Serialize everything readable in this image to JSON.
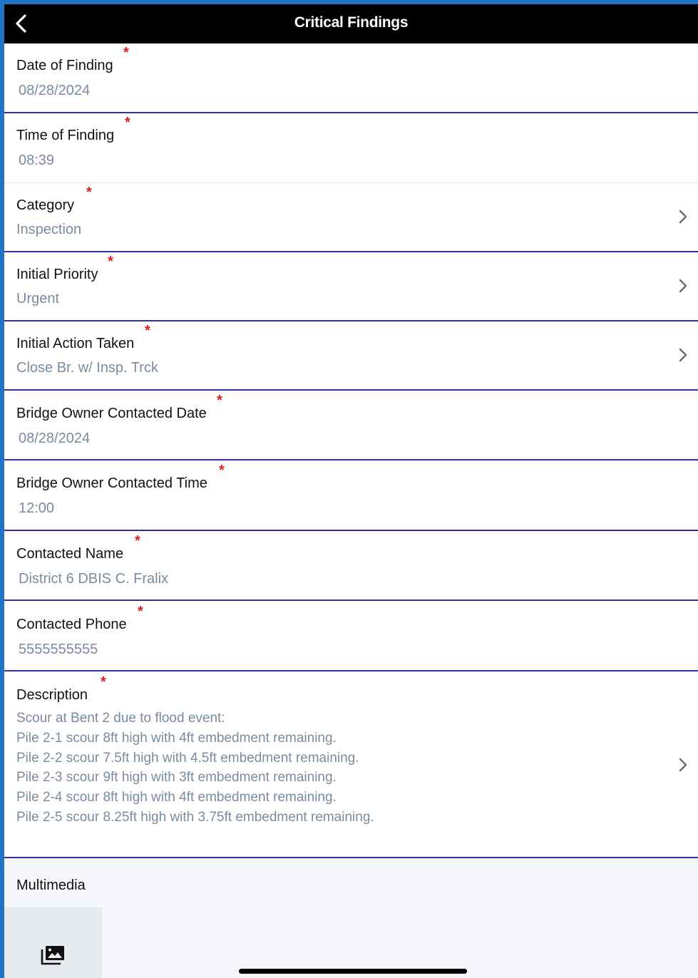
{
  "nav": {
    "title": "Critical Findings"
  },
  "fields": [
    {
      "label": "Date of Finding",
      "value": "08/28/2024",
      "required": true
    },
    {
      "label": "Time of Finding",
      "value": "08:39",
      "required": true
    },
    {
      "label": "Category",
      "value": "Inspection",
      "required": true
    },
    {
      "label": "Initial Priority",
      "value": "Urgent",
      "required": true
    },
    {
      "label": "Initial Action Taken",
      "value": "Close Br. w/ Insp. Trck",
      "required": true
    },
    {
      "label": "Bridge Owner Contacted Date",
      "value": "08/28/2024",
      "required": true
    },
    {
      "label": "Bridge Owner Contacted Time",
      "value": "12:00",
      "required": true
    },
    {
      "label": "Contacted Name",
      "value": "District 6 DBIS C. Fralix",
      "required": true
    },
    {
      "label": "Contacted Phone",
      "value": "5555555555",
      "required": true
    }
  ],
  "description": {
    "label": "Description",
    "required": true,
    "lines": [
      "Scour at Bent 2 due to flood event:",
      "Pile 2-1 scour 8ft high with 4ft embedment remaining.",
      "Pile 2-2 scour 7.5ft high with 4.5ft embedment remaining.",
      "Pile 2-3 scour 9ft high with 3ft embedment remaining.",
      "Pile 2-4 scour 8ft high with 4ft embedment remaining.",
      "Pile 2-5 scour 8.25ft high with 3.75ft embedment remaining."
    ]
  },
  "required_marker": "*",
  "multimedia": {
    "label": "Multimedia",
    "icon": "photo-library-icon"
  },
  "icons": {
    "back": "chevron-left-icon",
    "disclosure": "chevron-right-icon"
  },
  "colors": {
    "frame_blue": "#1f74c4",
    "nav_background": "#000000",
    "divider_blue": "#3030a8",
    "value_text": "#7a8ba0",
    "required_star": "#e01b1b"
  }
}
